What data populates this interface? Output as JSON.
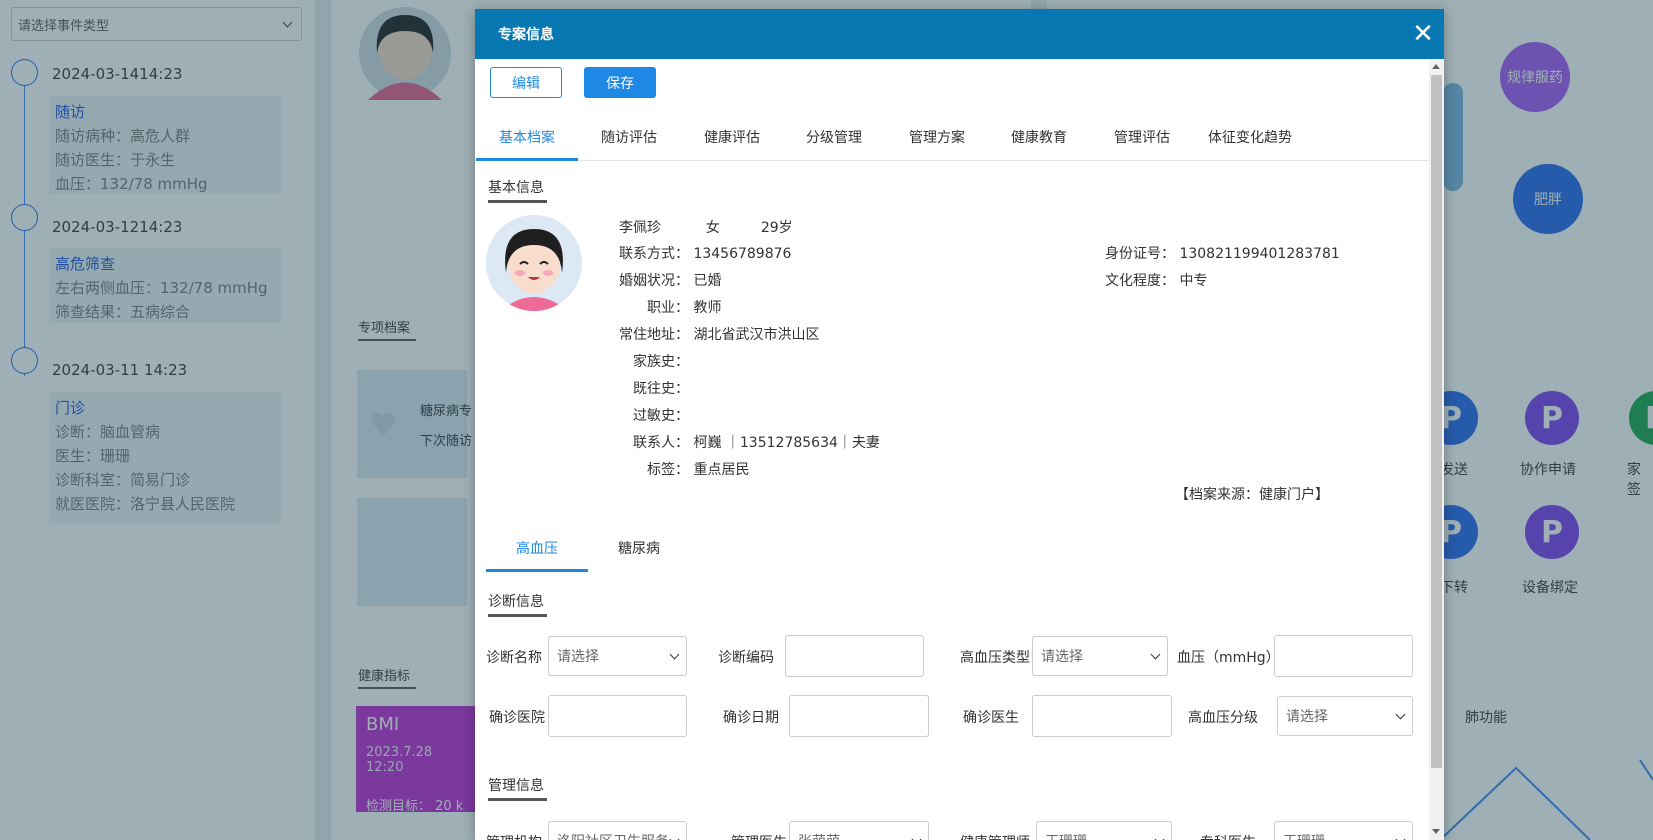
{
  "background": {
    "event_select": "请选择事件类型",
    "timeline": [
      {
        "time": "2024-03-1414:23",
        "title": "随访",
        "lines": [
          "随访病种：高危人群",
          "随访医生：于永生",
          "血压：132/78 mmHg"
        ]
      },
      {
        "time": "2024-03-1214:23",
        "title": "高危筛查",
        "lines": [
          "左右两侧血压：132/78 mmHg",
          "筛查结果：五病综合"
        ]
      },
      {
        "time": "2024-03-11 14:23",
        "title": "门诊",
        "lines": [
          "诊断：脑血管病",
          "医生：珊珊",
          "诊断科室：简易门诊",
          "就医医院：洛宁县人民医院"
        ]
      }
    ],
    "zx_head": "专项档案",
    "zx_card_text": "糖尿病专",
    "zx_card_sub": "下次随访",
    "health_head": "健康指标",
    "bmi": {
      "title": "BMI",
      "date": "2023.7.28 12:20",
      "target": "检测目标： 20 k"
    },
    "circles": [
      {
        "label": "规律服药",
        "color": "#a855f7"
      },
      {
        "label": "肥胖",
        "color": "#2563eb"
      }
    ],
    "right_icons": [
      {
        "label": "发送",
        "color": "#2563eb"
      },
      {
        "label": "协作申请",
        "color": "#7c3aed"
      },
      {
        "label": "家签",
        "color": "#16a34a"
      },
      {
        "label": "下转",
        "color": "#2563eb"
      },
      {
        "label": "设备绑定",
        "color": "#7c3aed"
      }
    ],
    "lung_label": "肺功能"
  },
  "modal": {
    "title": "专案信息",
    "edit_label": "编辑",
    "save_label": "保存",
    "tabs": [
      "基本档案",
      "随访评估",
      "健康评估",
      "分级管理",
      "管理方案",
      "健康教育",
      "管理评估",
      "体征变化趋势"
    ],
    "active_tab": 0,
    "basic_info_title": "基本信息",
    "profile": {
      "name": "李佩珍",
      "gender": "女",
      "age": "29岁",
      "contact_label": "联系方式：",
      "contact": "13456789876",
      "idno_label": "身份证号：",
      "idno": "130821199401283781",
      "marital_label": "婚姻状况：",
      "marital": "已婚",
      "education_label": "文化程度：",
      "education": "中专",
      "job_label": "职业：",
      "job": "教师",
      "address_label": "常住地址：",
      "address": "湖北省武汉市洪山区",
      "family_history_label": "家族史：",
      "past_history_label": "既往史：",
      "allergy_label": "过敏史：",
      "emergency_label": "联系人：",
      "emergency": "柯巍 ｜13512785634｜夫妻",
      "tag_label": "标签：",
      "tag": "重点居民",
      "source": "【档案来源：健康门户】"
    },
    "sub_tabs": [
      "高血压",
      "糖尿病"
    ],
    "active_sub_tab": 0,
    "diagnosis_title": "诊断信息",
    "form": {
      "diag_name_label": "诊断名称",
      "diag_name_value": "请选择",
      "diag_code_label": "诊断编码",
      "htn_type_label": "高血压类型",
      "htn_type_value": "请选择",
      "bp_label": "血压（mmHg）",
      "hospital_label": "确诊医院",
      "date_label": "确诊日期",
      "doctor_label": "确诊医生",
      "grade_label": "高血压分级",
      "grade_value": "请选择"
    },
    "management_title": "管理信息",
    "management": {
      "org_label": "管理机构",
      "org_value": "洛阳社区卫生服务",
      "doctor_label": "管理医生",
      "doctor_value": "张萌萌",
      "health_mgr_label": "健康管理师",
      "health_mgr_value": "王珊珊",
      "specialist_label": "专科医生",
      "specialist_value": "王珊珊"
    }
  }
}
